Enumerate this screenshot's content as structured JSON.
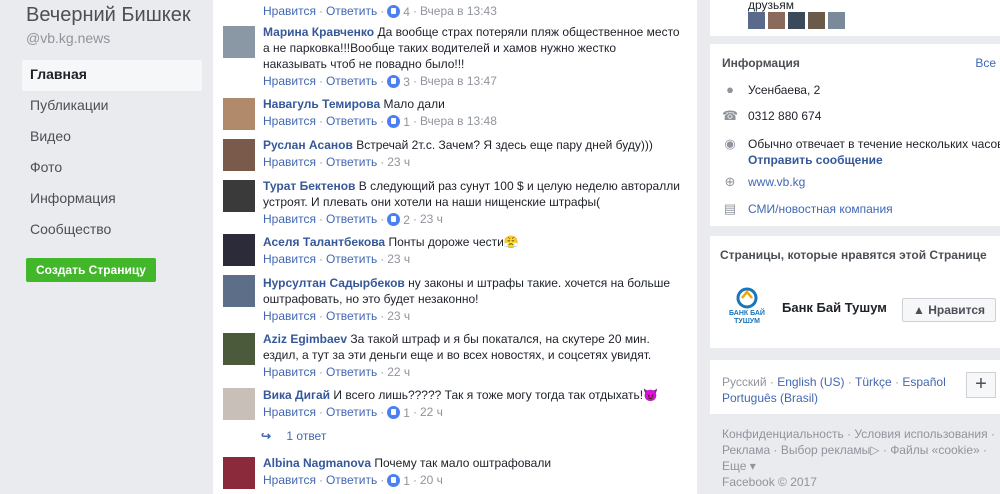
{
  "page": {
    "name": "Вечерний Бишкек",
    "handle": "@vb.kg.news"
  },
  "nav": {
    "items": [
      "Главная",
      "Публикации",
      "Видео",
      "Фото",
      "Информация",
      "Сообщество"
    ],
    "create_button": "Создать Страницу"
  },
  "actions": {
    "like": "Нравится",
    "reply": "Ответить",
    "separator": "·"
  },
  "top_partial": {
    "likes": "4",
    "time": "Вчера в 13:43"
  },
  "comments": [
    {
      "author": "Марина Кравченко",
      "text": "Да вообще страх потеряли пляж общественное место а не парковка!!!Вообще таких водителей и хамов нужно жестко наказывать чтоб не повадно было!!!",
      "likes": "3",
      "time": "Вчера в 13:47"
    },
    {
      "author": "Навагуль Темирова",
      "text": "Мало дали",
      "likes": "1",
      "time": "Вчера в 13:48"
    },
    {
      "author": "Руслан Асанов",
      "text": "Встречай 2т.с. Зачем? Я здесь еще пару дней буду)))",
      "likes": "",
      "time": "23 ч"
    },
    {
      "author": "Турат Бектенов",
      "text": "В следующий раз сунут 100 $ и целую неделю авторалли устроят. И плевать они хотели на наши нищенские штрафы(",
      "likes": "2",
      "time": "23 ч"
    },
    {
      "author": "Аселя Талантбекова",
      "text": "Понты дороже чести😤",
      "likes": "",
      "time": "23 ч"
    },
    {
      "author": "Нурсултан Садырбеков",
      "text": "ну законы и штрафы такие. хочется на больше оштрафовать, но это будет незаконно!",
      "likes": "",
      "time": "23 ч"
    },
    {
      "author": "Aziz Egimbaev",
      "text": "За такой штраф и я бы покатался, на скутере 20 мин. ездил, а тут за эти деньги еще и во всех новостях, и соцсетях увидят.",
      "likes": "",
      "time": "22 ч"
    },
    {
      "author": "Вика Дигай",
      "text": "И всего лишь????? Так я тоже могу тогда так отдыхать!😈",
      "likes": "1",
      "time": "22 ч"
    },
    {
      "author": "Albina Nagmanova",
      "text": "Почему так мало оштрафовали",
      "likes": "1",
      "time": "20 ч"
    }
  ],
  "reply_count": "1 ответ",
  "sidebar": {
    "friends_label": "друзьям",
    "info_title": "Информация",
    "info_all": "Все",
    "address": "Усенбаева, 2",
    "phone": "0312 880 674",
    "response": "Обычно отвечает в течение нескольких часов",
    "send_message": "Отправить сообщение",
    "website": "www.vb.kg",
    "category": "СМИ/новостная компания",
    "liked_title": "Страницы, которые нравятся этой Странице",
    "bank_name": "Банк Бай Тушум",
    "bank_logo_text": "БАНК БАЙ ТУШУМ",
    "like_page": "Нравится",
    "languages": [
      "Русский",
      "English (US)",
      "Türkçe",
      "Español",
      "Português (Brasil)"
    ],
    "plus": "+",
    "footer_links": [
      "Конфиденциальность",
      "Условия использования",
      "Реклама",
      "Выбор рекламы",
      "Файлы «cookie»",
      "Еще"
    ],
    "copyright": "Facebook © 2017"
  },
  "colors": {
    "link": "#365899",
    "action": "#4267b2",
    "create": "#42b72a",
    "background": "#e9ebee"
  }
}
